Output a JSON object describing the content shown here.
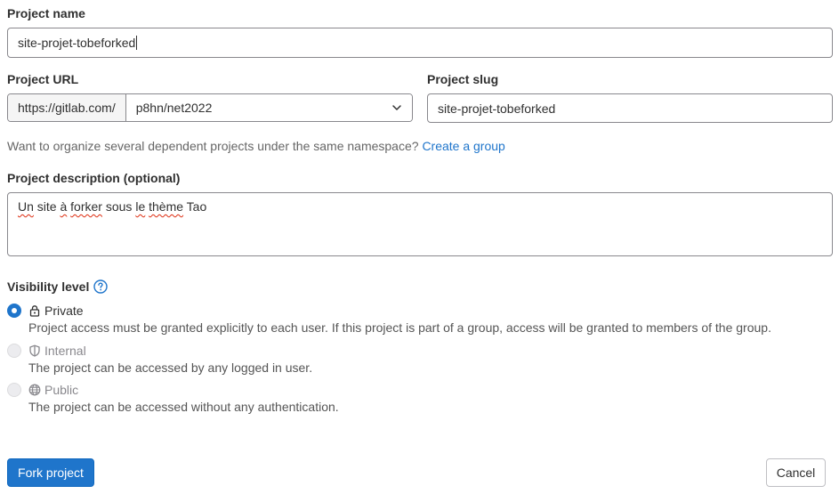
{
  "project_name": {
    "label": "Project name",
    "value": "site-projet-tobeforked"
  },
  "project_url": {
    "label": "Project URL",
    "prefix": "https://gitlab.com/",
    "namespace": "p8hn/net2022"
  },
  "project_slug": {
    "label": "Project slug",
    "value": "site-projet-tobeforked"
  },
  "namespace_hint": {
    "text": "Want to organize several dependent projects under the same namespace?",
    "link": "Create a group"
  },
  "description": {
    "label": "Project description (optional)",
    "parts": [
      "Un",
      " site ",
      "à",
      " ",
      "forker",
      " sous ",
      "le",
      " ",
      "thème",
      " Tao"
    ]
  },
  "visibility": {
    "label": "Visibility level",
    "options": [
      {
        "label": "Private",
        "icon": "lock-icon",
        "description": "Project access must be granted explicitly to each user. If this project is part of a group, access will be granted to members of the group.",
        "checked": true,
        "disabled": false
      },
      {
        "label": "Internal",
        "icon": "shield-icon",
        "description": "The project can be accessed by any logged in user.",
        "checked": false,
        "disabled": true
      },
      {
        "label": "Public",
        "icon": "earth-icon",
        "description": "The project can be accessed without any authentication.",
        "checked": false,
        "disabled": true
      }
    ]
  },
  "actions": {
    "fork": "Fork project",
    "cancel": "Cancel"
  },
  "colors": {
    "primary": "#1f75cb",
    "text": "#303030",
    "border": "#89888d"
  }
}
